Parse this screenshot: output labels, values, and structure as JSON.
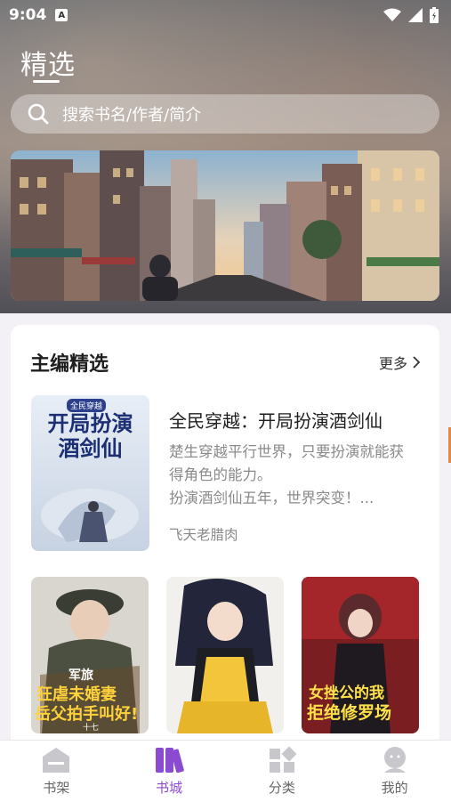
{
  "status_bar": {
    "time": "9:04",
    "notification_icon": "A"
  },
  "header": {
    "title": "精选"
  },
  "search": {
    "placeholder": "搜索书名/作者/简介"
  },
  "editor_picks": {
    "title": "主编精选",
    "more_label": "更多",
    "featured": {
      "title": "全民穿越：开局扮演酒剑仙",
      "description": "楚生穿越平行世界，只要扮演就能获得角色的能力。\n扮演酒剑仙五年，世界突变！...",
      "author": "飞天老腊肉",
      "cover_text": "开局扮演酒剑仙",
      "cover_badge": "全民穿越"
    },
    "books": [
      {
        "cover_text_1": "军旅",
        "cover_text_2": "狂虐未婚妻",
        "cover_text_3": "岳父拍手叫好!",
        "cover_author": "十七"
      },
      {
        "cover_text_1": ""
      },
      {
        "cover_text_1": "女挫公的我",
        "cover_text_2": "拒绝修罗场"
      }
    ]
  },
  "bottom_nav": {
    "items": [
      {
        "label": "书架",
        "icon": "bookshelf-icon"
      },
      {
        "label": "书城",
        "icon": "bookstore-icon",
        "active": true
      },
      {
        "label": "分类",
        "icon": "category-icon"
      },
      {
        "label": "我的",
        "icon": "profile-icon"
      }
    ],
    "active_color": "#8a4bd1"
  }
}
